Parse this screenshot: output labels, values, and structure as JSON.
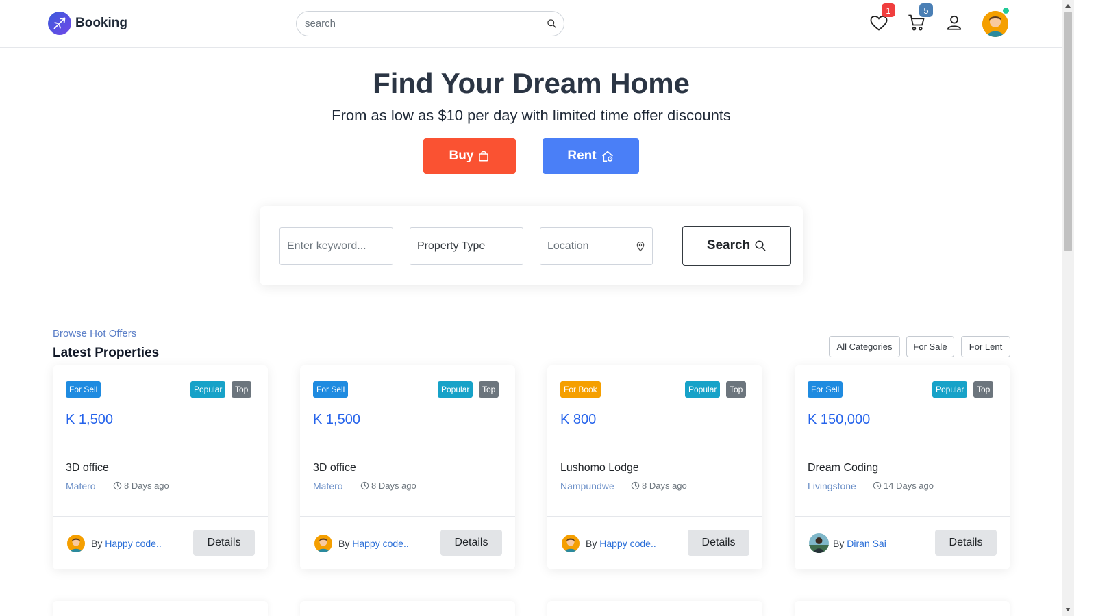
{
  "header": {
    "brand": "Booking",
    "search_placeholder": "search",
    "wishlist_count": "1",
    "cart_count": "5",
    "colors": {
      "brand": "#4c47d6",
      "wishlist_badge": "#f03e3e",
      "cart_badge": "#4a7fb5",
      "online": "#20c997"
    }
  },
  "hero": {
    "title": "Find Your Dream Home",
    "subtitle": "From as low as $10 per day with limited time offer discounts",
    "buy_label": "Buy",
    "rent_label": "Rent",
    "colors": {
      "buy": "#fa5232",
      "rent": "#4a7ff7"
    }
  },
  "filters": {
    "keyword_placeholder": "Enter keyword...",
    "property_type": "Property Type",
    "location_placeholder": "Location",
    "search_label": "Search"
  },
  "section": {
    "eyebrow": "Browse Hot Offers",
    "title": "Latest Properties",
    "tabs": [
      "All Categories",
      "For Sale",
      "For Lent"
    ]
  },
  "cards": [
    {
      "type": "For Sell",
      "type_color": "#1f8be0",
      "popular": "Popular",
      "top": "Top",
      "price": "K 1,500",
      "name": "3D office",
      "location": "Matero",
      "time": "8 Days ago",
      "by": "By",
      "author": "Happy code..",
      "details": "Details"
    },
    {
      "type": "For Sell",
      "type_color": "#1f8be0",
      "popular": "Popular",
      "top": "Top",
      "price": "K 1,500",
      "name": "3D office",
      "location": "Matero",
      "time": "8 Days ago",
      "by": "By",
      "author": "Happy code..",
      "details": "Details"
    },
    {
      "type": "For Book",
      "type_color": "#f59f00",
      "popular": "Popular",
      "top": "Top",
      "price": "K 800",
      "name": "Lushomo Lodge",
      "location": "Nampundwe",
      "time": "8 Days ago",
      "by": "By",
      "author": "Happy code..",
      "details": "Details"
    },
    {
      "type": "For Sell",
      "type_color": "#1f8be0",
      "popular": "Popular",
      "top": "Top",
      "price": "K 150,000",
      "name": "Dream Coding",
      "location": "Livingstone",
      "time": "14 Days ago",
      "by": "By",
      "author": "Diran Sai",
      "details": "Details"
    }
  ]
}
